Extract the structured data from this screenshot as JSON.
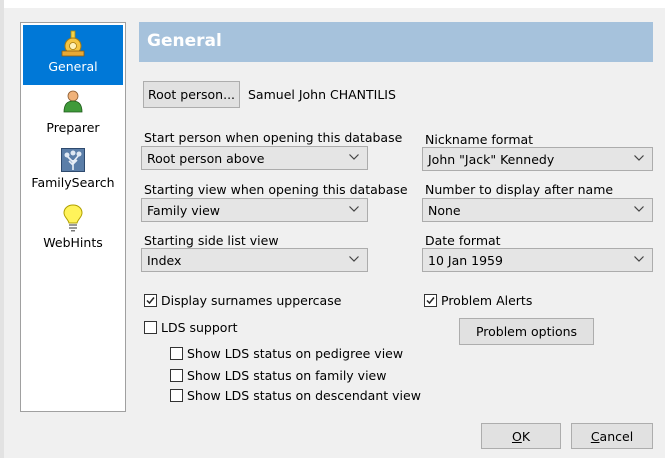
{
  "sidebar": {
    "items": [
      {
        "label": "General",
        "icon": "general-icon",
        "selected": true
      },
      {
        "label": "Preparer",
        "icon": "preparer-icon",
        "selected": false
      },
      {
        "label": "FamilySearch",
        "icon": "familysearch-icon",
        "selected": false
      },
      {
        "label": "WebHints",
        "icon": "webhints-icon",
        "selected": false
      }
    ]
  },
  "header": {
    "title": "General"
  },
  "root_person": {
    "button_label": "Root person...",
    "name": "Samuel John CHANTILIS"
  },
  "fields": {
    "start_person": {
      "label": "Start person when opening this database",
      "value": "Root person above"
    },
    "starting_view": {
      "label": "Starting view when opening this database",
      "value": "Family view"
    },
    "side_list": {
      "label": "Starting side list view",
      "value": "Index"
    },
    "nickname": {
      "label": "Nickname format",
      "value": "John \"Jack\" Kennedy"
    },
    "number_after_name": {
      "label": "Number to display after name",
      "value": "None"
    },
    "date_format": {
      "label": "Date format",
      "value": "10 Jan 1959"
    }
  },
  "checkboxes": {
    "surnames_upper": {
      "label": "Display surnames uppercase",
      "checked": true
    },
    "lds_support": {
      "label": "LDS support",
      "checked": false
    },
    "lds_pedigree": {
      "label": "Show LDS status on pedigree view",
      "checked": false
    },
    "lds_family": {
      "label": "Show LDS status on family view",
      "checked": false
    },
    "lds_descendant": {
      "label": "Show LDS status on descendant view",
      "checked": false
    },
    "problem_alerts": {
      "label": "Problem Alerts",
      "checked": true
    }
  },
  "buttons": {
    "problem_options": "Problem options",
    "ok_mnemonic": "O",
    "ok_rest": "K",
    "cancel_mnemonic": "C",
    "cancel_rest": "ancel"
  },
  "colors": {
    "header_bg": "#a6c2dc",
    "selected_bg": "#0078d7"
  }
}
